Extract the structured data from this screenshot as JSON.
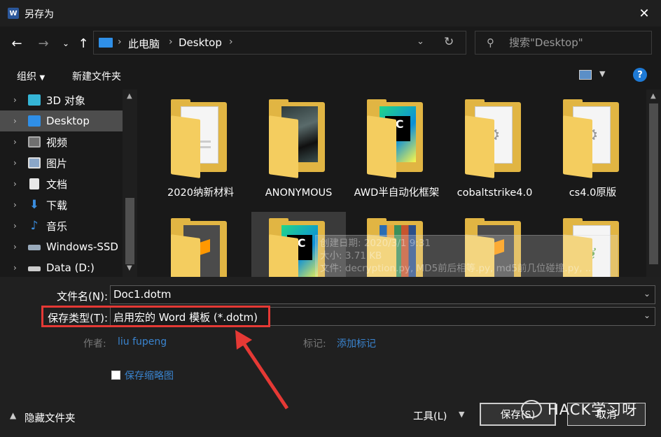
{
  "window": {
    "title": "另存为",
    "app_icon": "W"
  },
  "nav": {
    "breadcrumb": [
      "此电脑",
      "Desktop"
    ],
    "search_placeholder": "搜索\"Desktop\""
  },
  "toolbar": {
    "organize": "组织",
    "new_folder": "新建文件夹",
    "help": "?"
  },
  "sidebar": {
    "items": [
      {
        "label": "3D 对象",
        "icon": "3d-objects-icon",
        "color": "#35b5d6"
      },
      {
        "label": "Desktop",
        "icon": "desktop-icon",
        "color": "#2f8fe7",
        "selected": true
      },
      {
        "label": "视频",
        "icon": "videos-icon",
        "color": "#8a8a8a"
      },
      {
        "label": "图片",
        "icon": "pictures-icon",
        "color": "#8aa6c8"
      },
      {
        "label": "文档",
        "icon": "documents-icon",
        "color": "#c8c8c8"
      },
      {
        "label": "下载",
        "icon": "downloads-icon",
        "color": "#3a8ee0"
      },
      {
        "label": "音乐",
        "icon": "music-icon",
        "color": "#3a8ee0"
      },
      {
        "label": "Windows-SSD (",
        "icon": "drive-icon",
        "color": "#9ab"
      },
      {
        "label": "Data (D:)",
        "icon": "drive-icon",
        "color": "#ccc"
      }
    ]
  },
  "files": [
    {
      "name": "2020纳新材料",
      "thumb": "pdf"
    },
    {
      "name": "ANONYMOUS",
      "thumb": "photo"
    },
    {
      "name": "AWD半自动化框架",
      "thumb": "pycharm"
    },
    {
      "name": "cobaltstrike4.0",
      "thumb": "gear"
    },
    {
      "name": "cs4.0原版",
      "thumb": "gear"
    },
    {
      "name": "",
      "thumb": "sublime"
    },
    {
      "name": "",
      "thumb": "pycharm",
      "selected": true
    },
    {
      "name": "",
      "thumb": "books"
    },
    {
      "name": "",
      "thumb": "sublime"
    },
    {
      "name": "",
      "thumb": "leaf"
    }
  ],
  "tooltip": {
    "line1": "创建日期: 2020/3/1 9:31",
    "line2": "大小: 3.71 KB",
    "line3": "文件: decryption.py, MD5前后相等.py, md5前几位碰撞.py, ..."
  },
  "form": {
    "filename_label": "文件名(N):",
    "filename_value": "Doc1.dotm",
    "type_label": "保存类型(T):",
    "type_value": "启用宏的 Word 模板 (*.dotm)",
    "author_label": "作者:",
    "author_value": "liu fupeng",
    "tags_label": "标记:",
    "tags_value": "添加标记",
    "thumbnail_label": "保存缩略图",
    "hide_folders": "隐藏文件夹",
    "tools": "工具(L)",
    "save": "保存(S)",
    "cancel": "取消"
  },
  "watermark": "HACK学习呀",
  "colors": {
    "accent": "#3a84cf",
    "highlight": "#e53935",
    "folder": "#e1b543"
  }
}
